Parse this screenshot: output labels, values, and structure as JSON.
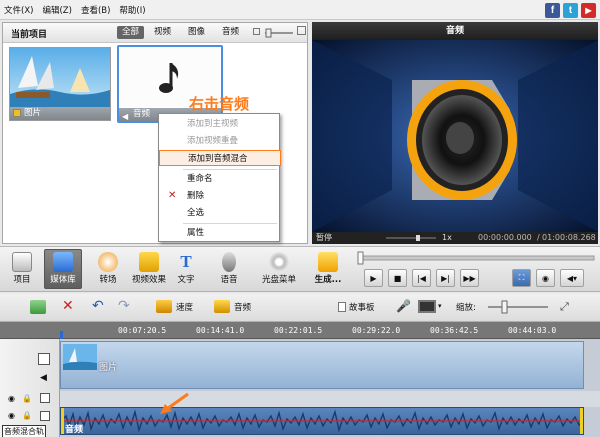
{
  "menubar": {
    "items": [
      "文件(X)",
      "编辑(Z)",
      "查看(B)",
      "帮助(I)"
    ]
  },
  "social": [
    {
      "label": "f",
      "color": "#3b5998"
    },
    {
      "label": "t",
      "color": "#2aa3d8"
    },
    {
      "label": "▶",
      "color": "#d32a2a"
    }
  ],
  "library": {
    "title": "当前项目",
    "tabs": [
      "全部",
      "视频",
      "图像",
      "音频"
    ],
    "active_tab": "全部",
    "items": [
      {
        "label": "图片",
        "type": "image"
      },
      {
        "label": "音频",
        "type": "audio"
      }
    ],
    "annotation": "右击音频"
  },
  "context_menu": {
    "items": [
      {
        "label": "添加到主视频",
        "enabled": false
      },
      {
        "label": "添加视频重叠",
        "enabled": false
      },
      {
        "label": "添加到音频混合",
        "enabled": true,
        "highlighted": true
      },
      {
        "label": "重命名",
        "enabled": true
      },
      {
        "label": "删除",
        "enabled": true
      },
      {
        "label": "全选",
        "enabled": true
      },
      {
        "label": "属性",
        "enabled": true
      }
    ]
  },
  "preview": {
    "title": "音频",
    "status": "暂停",
    "speed": "1x",
    "time_current": "00:00:00.000",
    "time_total": "01:00:08.268"
  },
  "toolbar": {
    "buttons": [
      "项目",
      "媒体库",
      "转场",
      "视频效果",
      "文字",
      "语音",
      "光盘菜单",
      "生成..."
    ],
    "active": "媒体库"
  },
  "timeline_toolbar": {
    "speed_label": "速度",
    "audio_label": "音频",
    "storyboard_label": "故事板",
    "zoom_label": "缩放:"
  },
  "ruler": {
    "ticks": [
      "00:07:20.5",
      "00:14:41.0",
      "00:22:01.5",
      "00:29:22.0",
      "00:36:42.5",
      "00:44:03.0"
    ]
  },
  "tracks": {
    "video_clip_label": "图片",
    "audio_clip_label": "音频",
    "audio_mix_track_label": "音频混合轨"
  },
  "colors": {
    "accent_orange": "#ff7a1a",
    "clip_blue": "#a9c3de",
    "audio_clip": "#3f6aa1",
    "waveform": "#1a3a6a",
    "audio_line": "#e02020"
  }
}
